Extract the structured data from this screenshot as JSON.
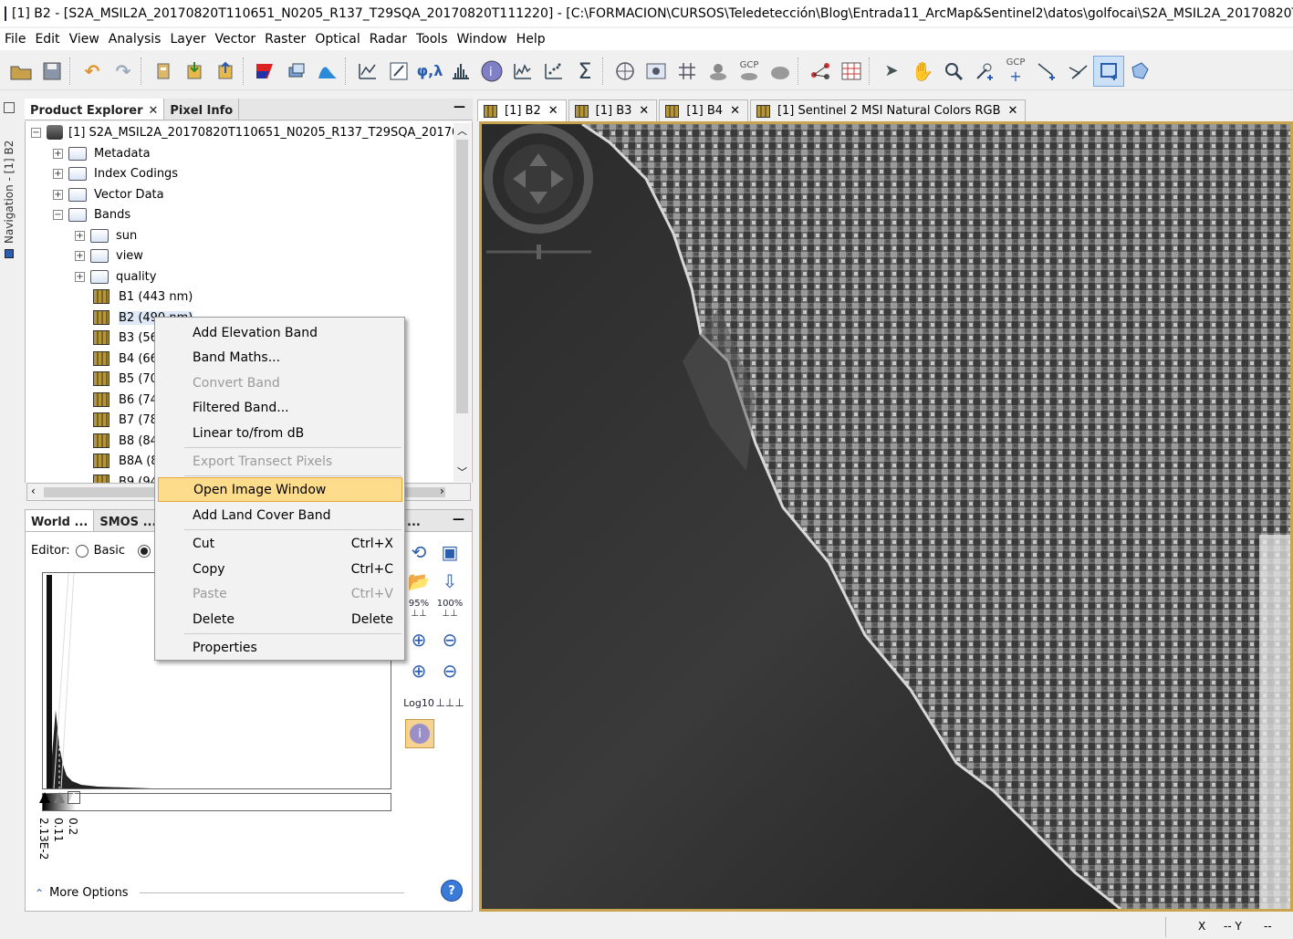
{
  "window": {
    "title": "[1] B2 - [S2A_MSIL2A_20170820T110651_N0205_R137_T29SQA_20170820T111220] - [C:\\FORMACION\\CURSOS\\Teledetección\\Blog\\Entrada11_ArcMap&Sentinel2\\datos\\golfocai\\S2A_MSIL2A_20170820T110651_"
  },
  "menu": [
    "File",
    "Edit",
    "View",
    "Analysis",
    "Layer",
    "Vector",
    "Raster",
    "Optical",
    "Radar",
    "Tools",
    "Window",
    "Help"
  ],
  "toolbar": {
    "gcp_label_1": "GCP",
    "gcp_label_2": "GCP",
    "icons": [
      "open-product-icon",
      "save-product-icon",
      "undo-icon",
      "redo-icon",
      "session-icon",
      "import-icon",
      "export-icon",
      "rgb-icon",
      "layers-icon",
      "wave-icon",
      "spectrum-icon",
      "edit-icon",
      "phi-lambda-icon",
      "histogram-icon",
      "info-icon",
      "profile-icon",
      "scatter-icon",
      "sum-icon",
      "world-map-icon",
      "overlay-icon",
      "grid-icon",
      "pin-icon",
      "gcp-icon",
      "mask-icon",
      "graph-icon",
      "matrix-icon",
      "select-icon",
      "pan-icon",
      "zoom-icon",
      "pin-add-icon",
      "gcp-add-icon",
      "line-draw-icon",
      "polyline-draw-icon",
      "rectangle-draw-icon",
      "polygon-draw-icon"
    ]
  },
  "nav_strip": {
    "label": "Navigation - [1] B2"
  },
  "product_explorer": {
    "tabs": [
      {
        "label": "Product Explorer",
        "close": "✕"
      },
      {
        "label": "Pixel Info"
      }
    ],
    "minimize": "—",
    "product": "[1] S2A_MSIL2A_20170820T110651_N0205_R137_T29SQA_201708",
    "nodes": [
      "Metadata",
      "Index Codings",
      "Vector Data",
      "Bands"
    ],
    "band_groups": [
      "sun",
      "view",
      "quality"
    ],
    "bands": [
      "B1 (443 nm)",
      "B2 (490 nm)",
      "B3 (56",
      "B4 (66",
      "B5 (70",
      "B6 (74",
      "B7 (78",
      "B8 (84",
      "B8A (8",
      "B9 (94"
    ]
  },
  "color_panel": {
    "tabs": [
      "World ...",
      "SMOS ...",
      "..."
    ],
    "minimize": "—",
    "editor_label": "Editor:",
    "editor_basic": "Basic",
    "editor_basic_checked": false,
    "editor_sliders_checked": true,
    "slider_values": [
      "2.13E-2",
      "0.11",
      "0.2"
    ],
    "tool_labels": {
      "pct95": "95%",
      "pct100": "100%",
      "log": "Log10"
    },
    "more_options": "More Options"
  },
  "image_tabs": [
    {
      "label": "[1] B2",
      "close": "✕"
    },
    {
      "label": "[1] B3",
      "close": "✕"
    },
    {
      "label": "[1] B4",
      "close": "✕"
    },
    {
      "label": "[1] Sentinel 2 MSI Natural Colors RGB",
      "close": "✕"
    }
  ],
  "context_menu": {
    "items": [
      {
        "label": "Add Elevation Band",
        "disabled": false
      },
      {
        "label": "Band Maths...",
        "disabled": false
      },
      {
        "label": "Convert Band",
        "disabled": true
      },
      {
        "label": "Filtered Band...",
        "disabled": false
      },
      {
        "label": "Linear to/from dB",
        "disabled": false
      },
      {
        "label": "Export Transect Pixels",
        "disabled": true
      },
      {
        "label": "Open Image Window",
        "disabled": false,
        "highlighted": true
      },
      {
        "label": "Add Land Cover Band",
        "disabled": false
      },
      {
        "label": "Cut",
        "shortcut": "Ctrl+X",
        "disabled": false
      },
      {
        "label": "Copy",
        "shortcut": "Ctrl+C",
        "disabled": false
      },
      {
        "label": "Paste",
        "shortcut": "Ctrl+V",
        "disabled": true
      },
      {
        "label": "Delete",
        "shortcut": "Delete",
        "disabled": false
      },
      {
        "label": "Properties",
        "disabled": false
      }
    ]
  },
  "status": {
    "x_label": "X",
    "y_label": "-- Y",
    "y_value": "--"
  },
  "colors": {
    "highlight": "#fddc8c",
    "image_border": "#c8a450",
    "accent": "#2a5db0"
  }
}
